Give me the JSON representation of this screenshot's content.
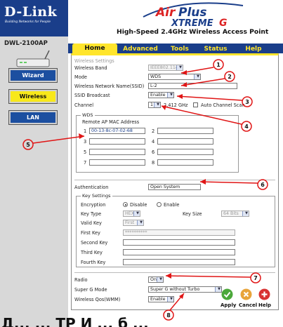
{
  "header": {
    "brand": "D-Link",
    "tagline": "Building Networks for People",
    "product_logo": "AirPlus XTREME G",
    "subtitle": "High-Speed 2.4GHz Wireless Access Point"
  },
  "sidebar": {
    "model": "DWL-2100AP",
    "items": [
      {
        "label": "Wizard"
      },
      {
        "label": "Wireless"
      },
      {
        "label": "LAN"
      }
    ]
  },
  "tabs": [
    {
      "label": "Home"
    },
    {
      "label": "Advanced"
    },
    {
      "label": "Tools"
    },
    {
      "label": "Status"
    },
    {
      "label": "Help"
    }
  ],
  "form": {
    "section_title": "Wireless Settings",
    "wireless_band": {
      "label": "Wireless Band",
      "value": "IEEE802.11g"
    },
    "mode": {
      "label": "Mode",
      "value": "WDS"
    },
    "ssid": {
      "label": "Wireless Network Name(SSID)",
      "value": "L-2"
    },
    "ssid_broadcast": {
      "label": "SSID Broadcast",
      "value": "Enable"
    },
    "channel": {
      "label": "Channel",
      "value": "1",
      "freq": "2.412 GHz",
      "auto_scan_label": "Auto Channel Scan"
    },
    "wds": {
      "legend": "WDS",
      "remote_label": "Remote AP MAC Address",
      "slots": [
        "1",
        "2",
        "3",
        "4",
        "5",
        "6",
        "7",
        "8"
      ],
      "slot1_value": "00-13-8c-07-02-68"
    },
    "authentication": {
      "label": "Authentication",
      "value": "Open System"
    },
    "key_settings": {
      "legend": "Key Settings",
      "encryption": {
        "label": "Encryption",
        "disable": "Disable",
        "enable": "Enable"
      },
      "key_type": {
        "label": "Key Type",
        "value": "HEX"
      },
      "key_size": {
        "label": "Key Size",
        "value": "64 Bits"
      },
      "valid_key": {
        "label": "Valid Key",
        "value": "First"
      },
      "first_key": {
        "label": "First Key",
        "value": "**********"
      },
      "second_key": {
        "label": "Second Key"
      },
      "third_key": {
        "label": "Third Key"
      },
      "fourth_key": {
        "label": "Fourth Key"
      }
    },
    "radio": {
      "label": "Radio",
      "value": "On"
    },
    "super_g": {
      "label": "Super G Mode",
      "value": "Super G without Turbo"
    },
    "qos": {
      "label": "Wireless Qos(WMM)",
      "value": "Enable"
    }
  },
  "actions": {
    "apply": "Apply",
    "cancel": "Cancel",
    "help": "Help"
  },
  "annotations": [
    "1",
    "2",
    "3",
    "4",
    "5",
    "6",
    "7",
    "8"
  ],
  "caption": "Д... ... ТР И ... б ..."
}
